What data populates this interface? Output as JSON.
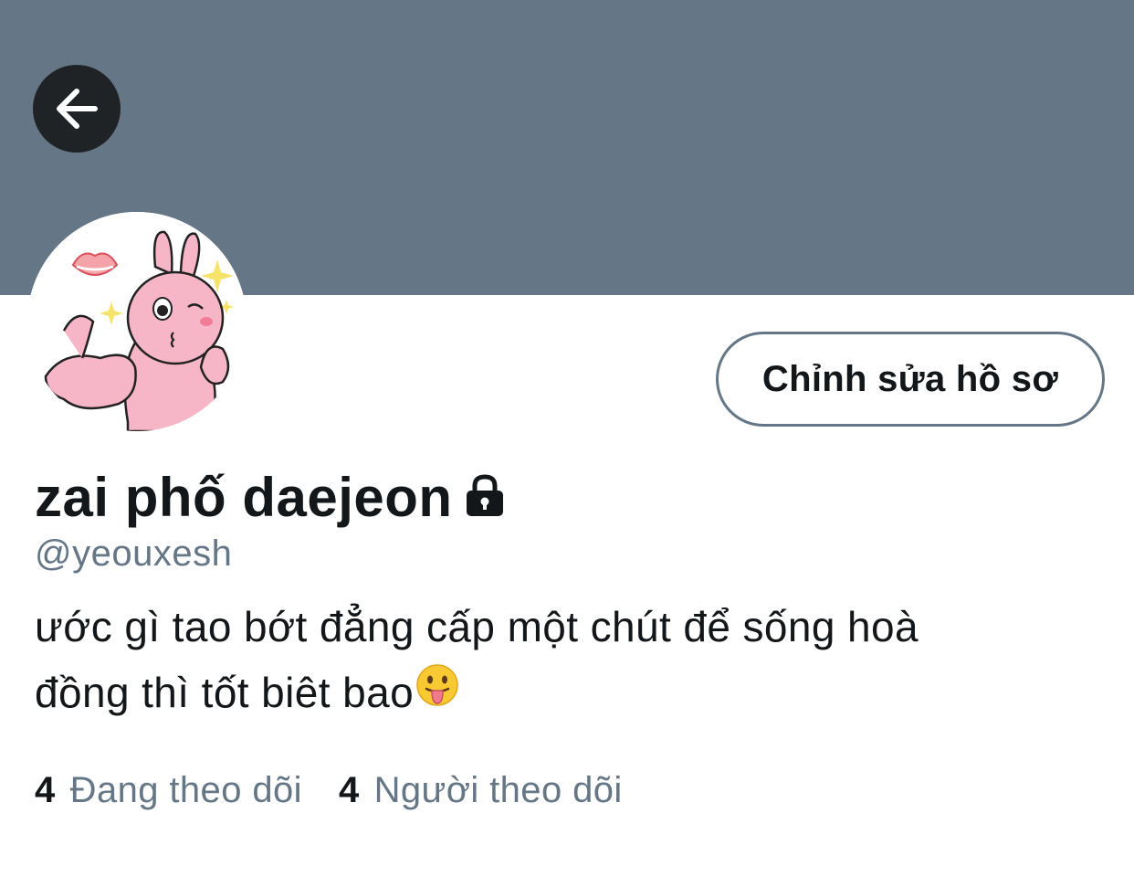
{
  "header": {
    "banner_color": "#657786",
    "back_icon": "arrow-left-icon"
  },
  "profile": {
    "display_name": "zai phố daejeon",
    "protected_icon": "lock-icon",
    "handle": "@yeouxesh",
    "bio_lines": [
      "ước gì tao bớt đẳng cấp một chút để sống hoà",
      "đồng thì tốt biêt bao"
    ],
    "bio_emoji": "face-with-tongue-emoji",
    "edit_button_label": "Chỉnh sửa hồ sơ"
  },
  "stats": {
    "following_count": "4",
    "following_label": "Đang theo dõi",
    "followers_count": "4",
    "followers_label": "Người theo dõi"
  },
  "colors": {
    "primary_text": "#14171a",
    "secondary_text": "#657786",
    "avatar_pink": "#f7b6c8"
  }
}
